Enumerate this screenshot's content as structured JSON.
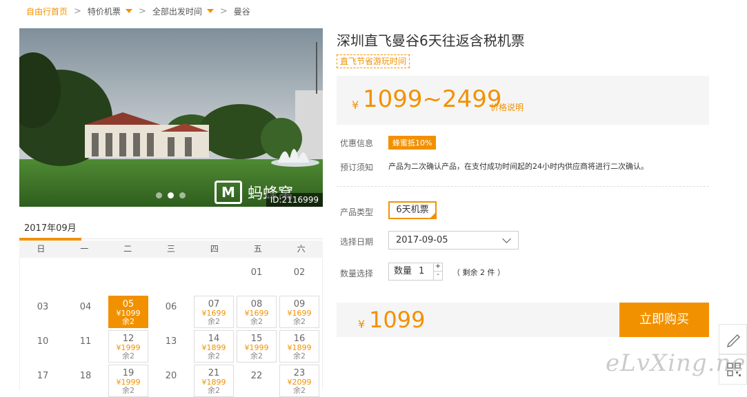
{
  "breadcrumb": {
    "home": "自由行首页",
    "items": [
      "特价机票",
      "全部出发时间",
      "曼谷"
    ],
    "sep": ">"
  },
  "gallery": {
    "image_id": "ID:2116999",
    "watermark": "蚂蜂窝",
    "dots": 3,
    "active_dot": 1
  },
  "calendar": {
    "month": "2017年09月",
    "weekdays": [
      "日",
      "一",
      "二",
      "三",
      "四",
      "五",
      "六"
    ],
    "cells": [
      {
        "day": "01",
        "row": 0,
        "col": 5,
        "price": "",
        "remain": ""
      },
      {
        "day": "02",
        "row": 0,
        "col": 6,
        "price": "",
        "remain": ""
      },
      {
        "day": "03",
        "row": 1,
        "col": 0,
        "price": "",
        "remain": ""
      },
      {
        "day": "04",
        "row": 1,
        "col": 1,
        "price": "",
        "remain": ""
      },
      {
        "day": "05",
        "row": 1,
        "col": 2,
        "price": "¥1099",
        "remain": "余2",
        "selected": true
      },
      {
        "day": "06",
        "row": 1,
        "col": 3,
        "price": "",
        "remain": ""
      },
      {
        "day": "07",
        "row": 1,
        "col": 4,
        "price": "¥1699",
        "remain": "余2"
      },
      {
        "day": "08",
        "row": 1,
        "col": 5,
        "price": "¥1699",
        "remain": "余2"
      },
      {
        "day": "09",
        "row": 1,
        "col": 6,
        "price": "¥1699",
        "remain": "余2"
      },
      {
        "day": "10",
        "row": 2,
        "col": 0,
        "price": "",
        "remain": ""
      },
      {
        "day": "11",
        "row": 2,
        "col": 1,
        "price": "",
        "remain": ""
      },
      {
        "day": "12",
        "row": 2,
        "col": 2,
        "price": "¥1999",
        "remain": "余2"
      },
      {
        "day": "13",
        "row": 2,
        "col": 3,
        "price": "",
        "remain": ""
      },
      {
        "day": "14",
        "row": 2,
        "col": 4,
        "price": "¥1899",
        "remain": "余2"
      },
      {
        "day": "15",
        "row": 2,
        "col": 5,
        "price": "¥1999",
        "remain": "余2"
      },
      {
        "day": "16",
        "row": 2,
        "col": 6,
        "price": "¥1899",
        "remain": "余2"
      },
      {
        "day": "17",
        "row": 3,
        "col": 0,
        "price": "",
        "remain": ""
      },
      {
        "day": "18",
        "row": 3,
        "col": 1,
        "price": "",
        "remain": ""
      },
      {
        "day": "19",
        "row": 3,
        "col": 2,
        "price": "¥1999",
        "remain": "余2"
      },
      {
        "day": "20",
        "row": 3,
        "col": 3,
        "price": "",
        "remain": ""
      },
      {
        "day": "21",
        "row": 3,
        "col": 4,
        "price": "¥1899",
        "remain": "余2"
      },
      {
        "day": "22",
        "row": 3,
        "col": 5,
        "price": "",
        "remain": ""
      },
      {
        "day": "23",
        "row": 3,
        "col": 6,
        "price": "¥2099",
        "remain": "余2"
      }
    ]
  },
  "product": {
    "title": "深圳直飞曼谷6天往返含税机票",
    "tag": "直飞节省游玩时间",
    "price_symbol": "¥",
    "price_range": "1099~2499",
    "price_note": "价格说明"
  },
  "info": {
    "promo_label": "优惠信息",
    "promo_badge": "蜂蜜抵10%",
    "notice_label": "预订须知",
    "notice_text": "产品为二次确认产品，在支付成功时间起的24小时内供应商将进行二次确认。",
    "type_label": "产品类型",
    "type_value": "6天机票",
    "date_label": "选择日期",
    "date_value": "2017-09-05",
    "qty_label": "数量选择",
    "qty_word": "数量",
    "qty_value": "1",
    "qty_plus": "+",
    "qty_minus": "-",
    "remain_text": "（ 剩余 2 件 ）"
  },
  "buy": {
    "price_symbol": "¥",
    "price": "1099",
    "button": "立即购买"
  },
  "site_watermark": "eLvXing.net",
  "colors": {
    "accent": "#f29100"
  },
  "side_icons": [
    "edit-icon",
    "qrcode-icon"
  ]
}
